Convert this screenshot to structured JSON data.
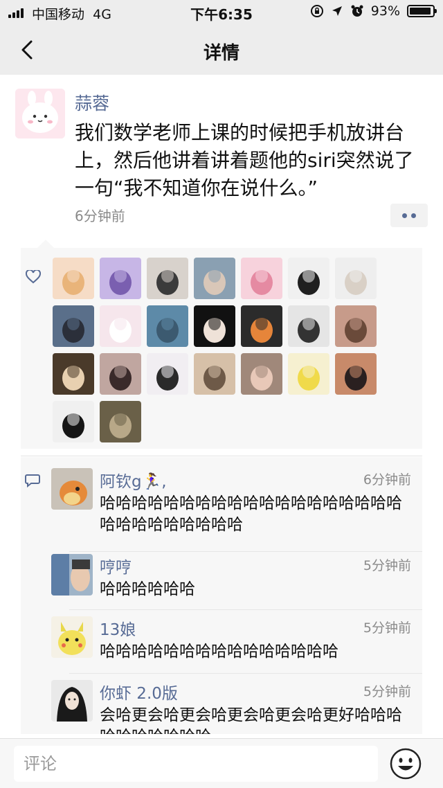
{
  "status_bar": {
    "carrier": "中国移动",
    "network": "4G",
    "time": "下午6:35",
    "battery": "93%",
    "battery_level": 0.93
  },
  "nav": {
    "title": "详情"
  },
  "post": {
    "author": "蒜蓉",
    "text": "我们数学老师上课的时候把手机放讲台上，然后他讲着讲着题他的siri突然说了一句“我不知道你在说什么。”",
    "time": "6分钟前"
  },
  "likes": {
    "count": 23
  },
  "comments": [
    {
      "name": "阿钦g🏃‍♀️,",
      "time": "6分钟前",
      "text": "哈哈哈哈哈哈哈哈哈哈哈哈哈哈哈哈哈哈哈哈哈哈哈哈哈哈哈哈"
    },
    {
      "name": "哼哼",
      "time": "5分钟前",
      "text": "哈哈哈哈哈哈"
    },
    {
      "name": "13娘",
      "time": "5分钟前",
      "text": "哈哈哈哈哈哈哈哈哈哈哈哈哈哈哈"
    },
    {
      "name": "你虾 2.0版",
      "time": "5分钟前",
      "text": "会哈更会哈更会哈更会哈更会哈更好哈哈哈哈哈哈哈哈哈哈"
    }
  ],
  "comment_input": {
    "placeholder": "评论"
  },
  "colors": {
    "link_blue": "#576b95",
    "bar_gray": "#ededed",
    "panel_gray": "#f7f7f7"
  }
}
